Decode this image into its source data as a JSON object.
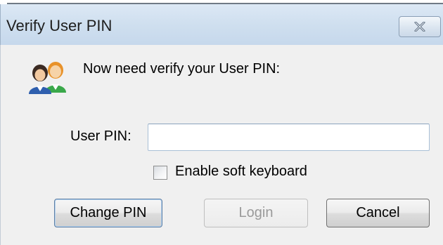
{
  "window": {
    "title": "Verify User PIN"
  },
  "dialog": {
    "message": "Now need verify your User PIN:",
    "pin_label": "User PIN:",
    "pin_value": "",
    "checkbox_label": "Enable soft keyboard",
    "checkbox_checked": false
  },
  "buttons": {
    "change_pin": "Change PIN",
    "login": "Login",
    "cancel": "Cancel"
  },
  "icons": {
    "close": "close-icon",
    "users": "users-icon"
  }
}
